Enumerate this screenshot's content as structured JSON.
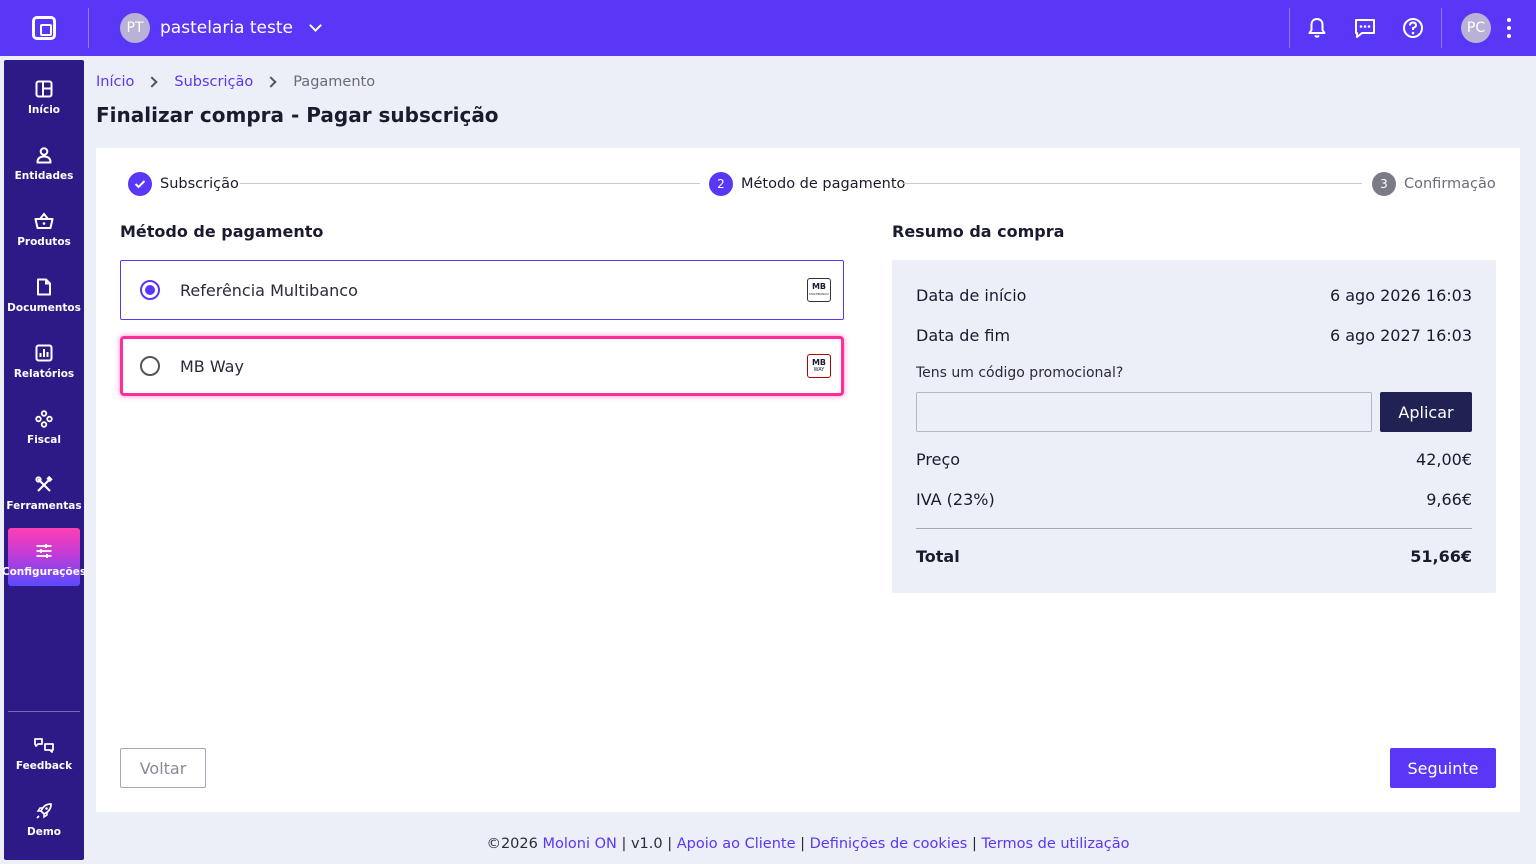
{
  "topbar": {
    "company_initials": "PT",
    "company_name": "pastelaria teste",
    "user_initials": "PC"
  },
  "sidebar": {
    "items": [
      {
        "label": "Início",
        "icon": "dashboard-icon"
      },
      {
        "label": "Entidades",
        "icon": "person-icon"
      },
      {
        "label": "Produtos",
        "icon": "basket-icon"
      },
      {
        "label": "Documentos",
        "icon": "document-icon"
      },
      {
        "label": "Relatórios",
        "icon": "chart-icon"
      },
      {
        "label": "Fiscal",
        "icon": "fiscal-icon"
      },
      {
        "label": "Ferramentas",
        "icon": "tools-icon"
      },
      {
        "label": "Configurações",
        "icon": "settings-sliders-icon",
        "active": true
      }
    ],
    "bottom": [
      {
        "label": "Feedback",
        "icon": "feedback-icon"
      },
      {
        "label": "Demo",
        "icon": "rocket-icon"
      }
    ]
  },
  "breadcrumb": {
    "home": "Início",
    "subscription": "Subscrição",
    "current": "Pagamento"
  },
  "page_title": "Finalizar compra - Pagar subscrição",
  "stepper": {
    "step1": {
      "label": "Subscrição",
      "state": "done"
    },
    "step2": {
      "number": "2",
      "label": "Método de pagamento",
      "state": "current"
    },
    "step3": {
      "number": "3",
      "label": "Confirmação",
      "state": "pending"
    }
  },
  "payment": {
    "heading": "Método de pagamento",
    "options": [
      {
        "label": "Referência Multibanco",
        "selected": true,
        "logo_text": "MB",
        "logo_sub": "MULTIBANCO"
      },
      {
        "label": "MB Way",
        "selected": false,
        "logo_text": "MB",
        "logo_sub": "WAY"
      }
    ]
  },
  "summary": {
    "heading": "Resumo da compra",
    "start_label": "Data de início",
    "start_value": "6 ago 2026 16:03",
    "end_label": "Data de fim",
    "end_value": "6 ago 2027 16:03",
    "promo_label": "Tens um código promocional?",
    "promo_value": "",
    "apply_label": "Aplicar",
    "price_label": "Preço",
    "price_value": "42,00€",
    "vat_label": "IVA (23%)",
    "vat_value": "9,66€",
    "total_label": "Total",
    "total_value": "51,66€"
  },
  "actions": {
    "back_label": "Voltar",
    "next_label": "Seguinte"
  },
  "footer": {
    "copyright": "©2026",
    "brand": "Moloni ON",
    "version": "v1.0",
    "support": "Apoio ao Cliente",
    "cookies": "Definições de cookies",
    "terms": "Termos de utilização",
    "sep": "|"
  },
  "colors": {
    "primary": "#5a36f6",
    "sidebar": "#2d1a86",
    "highlight": "#ff2d9b",
    "dark_button": "#202254"
  }
}
